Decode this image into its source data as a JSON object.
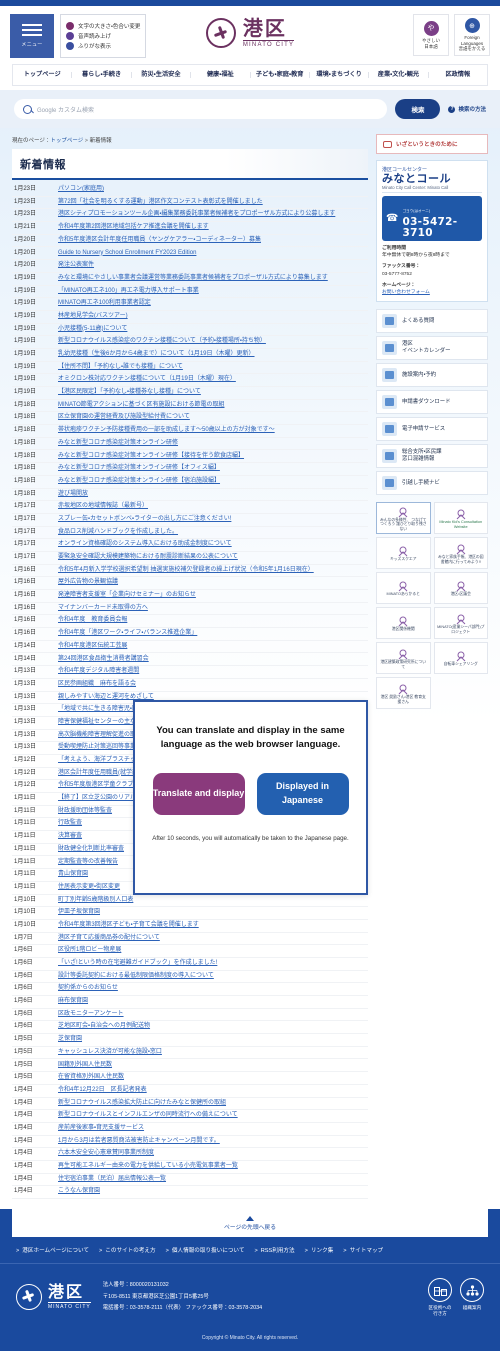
{
  "header": {
    "menu_label": "メニュー",
    "accessibility": [
      {
        "icon": "contrast-icon",
        "label": "文字の大きさ・色合い変更"
      },
      {
        "icon": "speaker-icon",
        "label": "音声読み上げ"
      },
      {
        "icon": "furigana-icon",
        "label": "ふりがな表示"
      }
    ],
    "brand_jp": "港区",
    "brand_en": "MINATO CITY",
    "lang_buttons": [
      {
        "glyph": "や",
        "label": "やさしい\n日本語",
        "label_line1": "やさしい",
        "label_line2": "日本語",
        "color": "#7b3f87"
      },
      {
        "glyph": "⊕",
        "label_line1": "Foreign",
        "label_line2": "Languages",
        "label_line3": "言語をかえる",
        "color": "#2f57a5"
      }
    ]
  },
  "gnav": [
    "トップページ",
    "暮らし・手続き",
    "防災・生活安全",
    "健康・福祉",
    "子ども・家庭・教育",
    "環境・まちづくり",
    "産業・文化・観光",
    "区政情報"
  ],
  "search": {
    "placeholder": "Google カスタム検索",
    "button_label": "検索",
    "how_label": "検索の方法"
  },
  "breadcrumb": {
    "prefix": "現在のページ：",
    "home": "トップページ",
    "separator": " > ",
    "current": "新着情報"
  },
  "page_title": "新着情報",
  "news": [
    {
      "date": "1月23日",
      "title": "パソコン(家庭用)"
    },
    {
      "date": "1月23日",
      "title": "第72回「社会を明るくする運動」港区作文コンテスト表彰式を開催しました"
    },
    {
      "date": "1月23日",
      "title": "港区シティプロモーションツール企画・編集業務委託事業者候補者をプロポーザル方式により公募します"
    },
    {
      "date": "1月21日",
      "title": "令和4年度第2回港区地域包括ケア推進会議を開催します"
    },
    {
      "date": "1月20日",
      "title": "令和5年度港区会計年度任用職員（ヤングケアラー・コーディネーター）募集"
    },
    {
      "date": "1月20日",
      "title": "Guide to Nursery School Enrollment FY2023 Edition"
    },
    {
      "date": "1月20日",
      "title": "発注公表案件"
    },
    {
      "date": "1月19日",
      "title": "みなと環境にやさしい事業者会議運営等業務委託事業者候補者をプロポーザル方式により募集します"
    },
    {
      "date": "1月19日",
      "title": "「MINATO再エネ100」再エネ電力導入サポート事業"
    },
    {
      "date": "1月19日",
      "title": "MINATO再エネ100利用事業者認定"
    },
    {
      "date": "1月19日",
      "title": "林産地見学会(バスツアー)"
    },
    {
      "date": "1月19日",
      "title": "小児接種(5-11歳)について"
    },
    {
      "date": "1月19日",
      "title": "新型コロナウイルス感染症のワクチン接種について（予約・接種場所・持ち物）"
    },
    {
      "date": "1月19日",
      "title": "乳幼児接種（生後6か月から4歳まで）について（1月19日（木曜）更新）"
    },
    {
      "date": "1月19日",
      "title": "【住所不問】「予約なし・誰でも接種」について"
    },
    {
      "date": "1月19日",
      "title": "オミクロン株対応ワクチン接種について（1月19日（木曜）現在）"
    },
    {
      "date": "1月19日",
      "title": "【港区民限定】「予約なし・接種券なし接種」について"
    },
    {
      "date": "1月18日",
      "title": "MINATO節電アクションに基づく区有施設における節電の取組"
    },
    {
      "date": "1月18日",
      "title": "区立保育園の運営経費及び施設型給付費について"
    },
    {
      "date": "1月18日",
      "title": "帯状疱疹ワクチン予防接種費用の一部を助成します～50歳以上の方が対象です～"
    },
    {
      "date": "1月18日",
      "title": "みなと新型コロナ感染症対策オンライン研修"
    },
    {
      "date": "1月18日",
      "title": "みなと新型コロナ感染症対策オンライン研修【接待を伴う飲食店編】"
    },
    {
      "date": "1月18日",
      "title": "みなと新型コロナ感染症対策オンライン研修【オフィス編】"
    },
    {
      "date": "1月18日",
      "title": "みなと新型コロナ感染症対策オンライン研修【宿泊施設編】"
    },
    {
      "date": "1月18日",
      "title": "遊び場開放"
    },
    {
      "date": "1月17日",
      "title": "赤坂地区の地域情報誌（最新号）"
    },
    {
      "date": "1月17日",
      "title": "スプレー缶・カセットボンベ・ライターの出し方にご注意ください!"
    },
    {
      "date": "1月17日",
      "title": "食品ロス削減ハンドブックを作成しました。"
    },
    {
      "date": "1月17日",
      "title": "オンライン資格確認のシステム導入における助成金制度について"
    },
    {
      "date": "1月17日",
      "title": "要緊急安全確認大規模建築物における耐震診断結果の公表について"
    },
    {
      "date": "1月16日",
      "title": "令和5年4月新入学学校選択希望制 抽選実施校補欠登録者の繰上げ状況（令和5年1月16日現在）"
    },
    {
      "date": "1月16日",
      "title": "屋外広告物の景観協議"
    },
    {
      "date": "1月16日",
      "title": "発達障害者支援室「企業向けセミナー」のお知らせ"
    },
    {
      "date": "1月16日",
      "title": "マイナンバーカード未取得の方へ"
    },
    {
      "date": "1月16日",
      "title": "令和4年度　教育委員会報"
    },
    {
      "date": "1月16日",
      "title": "令和4年度「港区ワーク・ライフ・バランス推進企業」"
    },
    {
      "date": "1月14日",
      "title": "令和4年度港区伝統工芸展"
    },
    {
      "date": "1月14日",
      "title": "第24回港区食品衛生消費者講習会"
    },
    {
      "date": "1月13日",
      "title": "令和4年度デジタル障害者週間"
    },
    {
      "date": "1月13日",
      "title": "区民参画組織　麻布を語る会"
    },
    {
      "date": "1月13日",
      "title": "親しみやすい海辺と運河をめざして"
    },
    {
      "date": "1月13日",
      "title": "「地域で共に生きる障害児・障害者」～知ってほしい、忘れないこと～"
    },
    {
      "date": "1月13日",
      "title": "障害保健福祉センターの主な事業"
    },
    {
      "date": "1月13日",
      "title": "高次脳機能障害理解促進の取組"
    },
    {
      "date": "1月13日",
      "title": "受動喫煙防止対策巡回等事業"
    },
    {
      "date": "1月12日",
      "title": "「考えよう、海洋プラスチック問題」"
    },
    {
      "date": "1月12日",
      "title": "港区会計年度任用職員(就学前教育)"
    },
    {
      "date": "1月12日",
      "title": "令和5年度版港区学童クラブ入会のご案内"
    },
    {
      "date": "1月11日",
      "title": "【終了】区立芝公園のリアルタイムな混雑状況を配信します"
    },
    {
      "date": "1月11日",
      "title": "財政援助団体等監査"
    },
    {
      "date": "1月11日",
      "title": "行政監査"
    },
    {
      "date": "1月11日",
      "title": "決算審査"
    },
    {
      "date": "1月11日",
      "title": "財政健全化判断比率審査"
    },
    {
      "date": "1月11日",
      "title": "定期監査等の改善報告"
    },
    {
      "date": "1月11日",
      "title": "青山保育園"
    },
    {
      "date": "1月11日",
      "title": "住居表示変更・街区変更"
    },
    {
      "date": "1月10日",
      "title": "町丁別年齢5歳階級別人口表"
    },
    {
      "date": "1月10日",
      "title": "伊皿子坂保育園"
    },
    {
      "date": "1月10日",
      "title": "令和4年度第3回港区子ども・子育て会議を開催します"
    },
    {
      "date": "1月7日",
      "title": "港区子育て応援商品券の配付について"
    },
    {
      "date": "1月6日",
      "title": "区役所1階ロビー物産展"
    },
    {
      "date": "1月6日",
      "title": "「いざ!という時の在宅避難ガイドブック」を作成しました!"
    },
    {
      "date": "1月6日",
      "title": "設計等委託契約における最低制限価格制度の導入について"
    },
    {
      "date": "1月6日",
      "title": "契約係からのお知らせ"
    },
    {
      "date": "1月6日",
      "title": "麻布保育園"
    },
    {
      "date": "1月6日",
      "title": "区政モニターアンケート"
    },
    {
      "date": "1月6日",
      "title": "芝地区町会・自治会への月例配送物"
    },
    {
      "date": "1月5日",
      "title": "芝保育園"
    },
    {
      "date": "1月5日",
      "title": "キャッシュレス決済が可能な施設・窓口"
    },
    {
      "date": "1月5日",
      "title": "国籍別外国人住民数"
    },
    {
      "date": "1月5日",
      "title": "在留資格別外国人住民数"
    },
    {
      "date": "1月4日",
      "title": "令和4年12月22日　区長記者発表"
    },
    {
      "date": "1月4日",
      "title": "新型コロナウイルス感染拡大防止に向けたみなと保健所の取組"
    },
    {
      "date": "1月4日",
      "title": "新型コロナウイルスとインフルエンザの同時流行への備えについて"
    },
    {
      "date": "1月4日",
      "title": "産前産後家事・育児支援サービス"
    },
    {
      "date": "1月4日",
      "title": "1月から3月は若者悪質商法被害防止キャンペーン月間です。"
    },
    {
      "date": "1月4日",
      "title": "六本木安全安心憲章賛同事業所制度"
    },
    {
      "date": "1月4日",
      "title": "再生可能エネルギー由来の電力を供給している小売電気事業者一覧"
    },
    {
      "date": "1月4日",
      "title": "住宅宿泊事業（民泊）届出情報公表一覧"
    },
    {
      "date": "1月4日",
      "title": "こうなん保育園"
    }
  ],
  "sidebar": {
    "alert": {
      "icon": "megaphone-icon",
      "label": "いざというときのために"
    },
    "callcenter": {
      "kicker": "港区コールセンター",
      "title": "みなとコール",
      "subtitle": "Minato City Call Center: Minato Call",
      "phone_ruby_1": "電話",
      "phone_ruby_2": "ゴヨウ(はオーニ)",
      "phone_ruby_3": "ミナト",
      "phone": "03-5472-3710",
      "hours_label": "ご利用時間",
      "hours_value": "年中無休で朝8時から夜8時まで",
      "fax_label": "ファックス番号：",
      "fax_value": "03-5777-8752",
      "home_label": "ホームページ：",
      "home_link": "お問い合わせフォーム"
    },
    "menu": [
      {
        "icon": "faq-icon",
        "label": "よくある質問"
      },
      {
        "icon": "calendar-icon",
        "label": "港区\nイベントカレンダー",
        "line1": "港区",
        "line2": "イベントカレンダー"
      },
      {
        "icon": "facility-icon",
        "label": "施設案内・予約"
      },
      {
        "icon": "download-icon",
        "label": "申請書ダウンロード"
      },
      {
        "icon": "eservice-icon",
        "label": "電子申請サービス"
      },
      {
        "icon": "counter-icon",
        "label": "総合支所・区民課\n窓口混雑情報",
        "line1": "総合支所・区民課",
        "line2": "窓口混雑情報"
      },
      {
        "icon": "moving-icon",
        "label": "引越し手続ナビ"
      }
    ],
    "banners": [
      {
        "icon": "diversity-icon",
        "label": "みんなの多様性、\nつなげてつくろう\n誰ひとり取り残さない",
        "highlight": true
      },
      {
        "icon": "kids-icon",
        "label": "Minato Kid's Consultation Website",
        "green": true
      },
      {
        "icon": "kidsquare-icon",
        "label": "キッズスクエア"
      },
      {
        "icon": "book-icon",
        "label": "みなと家族手帳、港区の図書館内に行ってみよう!!"
      },
      {
        "icon": "speaker-icon",
        "label": "MINATOあらかると"
      },
      {
        "icon": "mail-icon",
        "label": "港区・区議会"
      },
      {
        "icon": "shop-icon",
        "label": "港区関係機関"
      },
      {
        "icon": "bag-icon",
        "label": "MINATO(産業シーパ部門)プロジェクト"
      },
      {
        "icon": "doc-icon",
        "label": "港区建築政策研究所について"
      },
      {
        "icon": "bicycle-icon",
        "label": "自転車シェアリング"
      },
      {
        "icon": "ticket-icon",
        "label": "港区 奨励さん・港区 教育支援さん"
      }
    ]
  },
  "modal": {
    "message": "You can translate and display in the same language as the web browser language.",
    "translate_button": "Translate and display",
    "japanese_button": "Displayed in Japanese",
    "note": "After 10 seconds, you will automatically be taken to the Japanese page."
  },
  "back_to_top": "ページの先頭へ戻る",
  "footer": {
    "links": [
      "港区ホームページについて",
      "このサイトの考え方",
      "個人情報の取り扱いについて",
      "RSS利用方法",
      "リンク集",
      "サイトマップ"
    ],
    "brand_jp": "港区",
    "brand_en": "MINATO CITY",
    "corporate_number": "法人番号：8000020131032",
    "address": "〒105-8511 東京都港区芝公園1丁目5番25号",
    "tel": "電話番号：03-3578-2111（代表） ファックス番号：03-3578-2034",
    "icons": [
      {
        "icon": "building-icon",
        "label": "区役所への\n行き方",
        "line1": "区役所への",
        "line2": "行き方"
      },
      {
        "icon": "orgchart-icon",
        "label": "組織案内",
        "line1": "組織案内",
        "line2": ""
      }
    ],
    "copyright": "Copyright © Minato City. All rights reserved."
  }
}
